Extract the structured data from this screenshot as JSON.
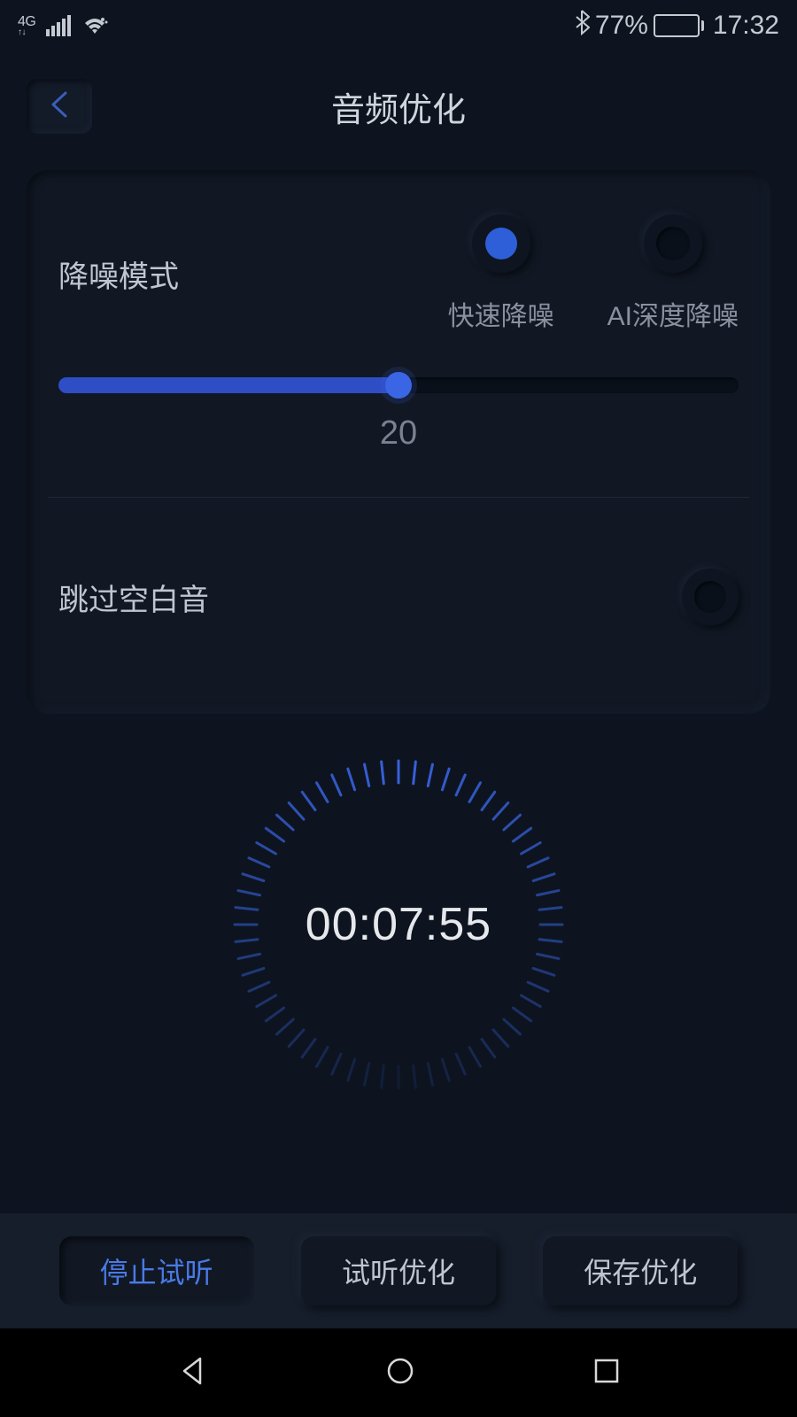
{
  "status_bar": {
    "network": "4G",
    "bluetooth_icon": "bluetooth",
    "battery_percent": "77%",
    "time": "17:32"
  },
  "header": {
    "title": "音频优化"
  },
  "noise_reduction": {
    "label": "降噪模式",
    "options": {
      "fast": {
        "label": "快速降噪",
        "selected": true
      },
      "ai_deep": {
        "label": "AI深度降噪",
        "selected": false
      }
    },
    "slider_value": "20",
    "slider_percent": 50
  },
  "skip_silence": {
    "label": "跳过空白音",
    "enabled": false
  },
  "timer": {
    "display": "00:07:55"
  },
  "actions": {
    "stop_preview": "停止试听",
    "preview_optimize": "试听优化",
    "save_optimize": "保存优化"
  }
}
